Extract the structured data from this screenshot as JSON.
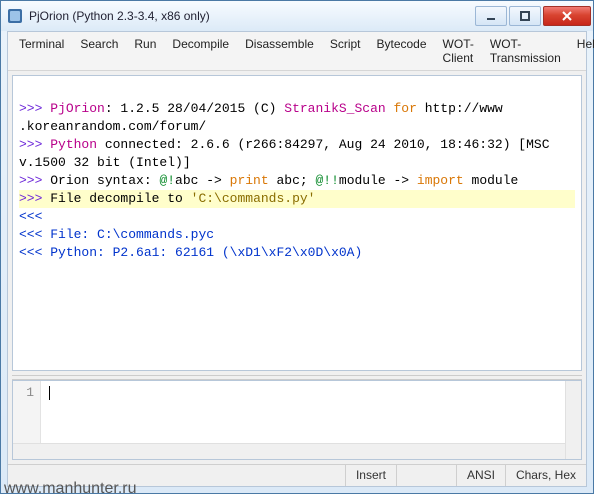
{
  "window": {
    "title": "PjOrion (Python 2.3-3.4, x86 only)"
  },
  "menu": {
    "items": [
      "Terminal",
      "Search",
      "Run",
      "Decompile",
      "Disassemble",
      "Script",
      "Bytecode",
      "WOT-Client",
      "WOT-Transmission",
      "Help"
    ]
  },
  "console": {
    "l1_prompt": ">>> ",
    "l1_app": "PjOrion",
    "l1_a": ": 1.2.5 28/04/2015 (C) ",
    "l1_name": "StranikS_Scan",
    "l1_b": " ",
    "l1_for": "for",
    "l1_c": " http://www",
    "l1_d": ".koreanrandom.com/forum/",
    "l2_prompt": ">>> ",
    "l2_py": "Python",
    "l2_a": " connected: 2.6.6 (r266:84297, Aug 24 2010, 18:46:32) [MSC ",
    "l2_b": "v.1500 32 bit (Intel)]",
    "l3_prompt": ">>> ",
    "l3_a": "Orion syntax: ",
    "l3_at1": "@!",
    "l3_abc1": "abc -> ",
    "l3_print": "print",
    "l3_abc2": " abc; ",
    "l3_at2": "@!!",
    "l3_mod1": "module -> ",
    "l3_import": "import",
    "l3_mod2": " module",
    "l4_prompt": ">>> ",
    "l4_a": "File decompile to ",
    "l4_path": "'C:\\commands.py'",
    "l5": "<<<",
    "l6_prompt": "<<< ",
    "l6_a": "File: C:\\commands.pyc",
    "l7_prompt": "<<< ",
    "l7_a": "Python: P2.6a1: 62161 (\\xD1\\xF2\\x0D\\x0A)"
  },
  "editor": {
    "line_no": "1"
  },
  "status": {
    "insert": "Insert",
    "encoding": "ANSI",
    "mode": "Chars, Hex"
  },
  "watermark": "www.manhunter.ru"
}
